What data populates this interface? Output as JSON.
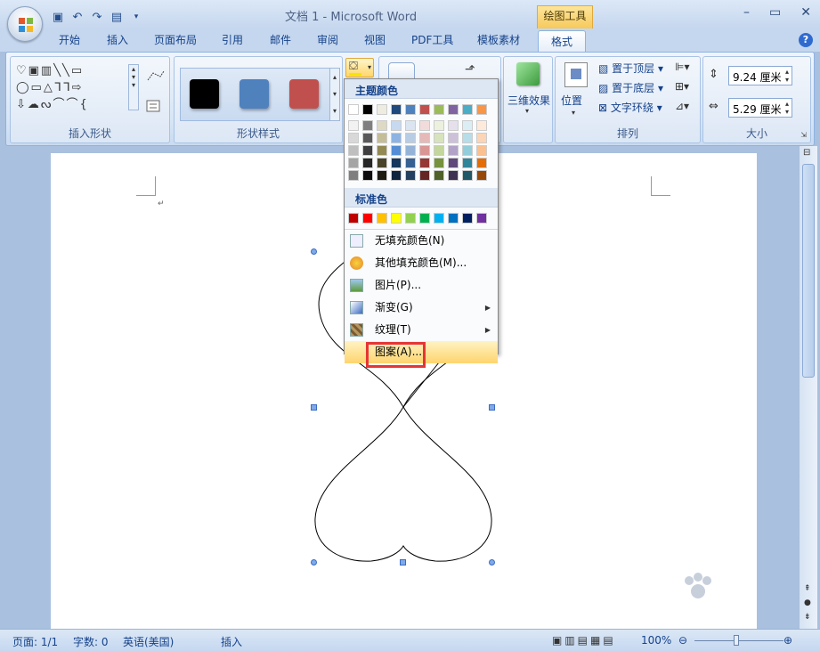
{
  "window": {
    "title": "文档 1 - Microsoft Word",
    "context_tab": "绘图工具"
  },
  "tabs": [
    {
      "label": "开始"
    },
    {
      "label": "插入"
    },
    {
      "label": "页面布局"
    },
    {
      "label": "引用"
    },
    {
      "label": "邮件"
    },
    {
      "label": "审阅"
    },
    {
      "label": "视图"
    },
    {
      "label": "PDF工具"
    },
    {
      "label": "模板素材"
    },
    {
      "label": "格式"
    }
  ],
  "groups": {
    "insert_shapes": "插入形状",
    "shape_styles": "形状样式",
    "arrange": "排列",
    "size": "大小",
    "three_d": "三维效果",
    "position": "位置"
  },
  "arrange": {
    "bring_front": "置于顶层",
    "send_back": "置于底层",
    "text_wrap": "文字环绕"
  },
  "size": {
    "height": "9.24 厘米",
    "width": "5.29 厘米"
  },
  "style_swatches": [
    "#000000",
    "#4f81bd",
    "#c0504d"
  ],
  "fill_menu": {
    "theme_header": "主题颜色",
    "standard_header": "标准色",
    "theme_top": [
      "#ffffff",
      "#000000",
      "#eeece1",
      "#1f497d",
      "#4f81bd",
      "#c0504d",
      "#9bbb59",
      "#8064a2",
      "#4bacc6",
      "#f79646"
    ],
    "theme_shades": [
      [
        "#f2f2f2",
        "#7f7f7f",
        "#ddd9c3",
        "#c6d9f0",
        "#dbe5f1",
        "#f2dcdb",
        "#ebf1dd",
        "#e5e0ec",
        "#dbeef3",
        "#fdeada"
      ],
      [
        "#d8d8d8",
        "#595959",
        "#c4bd97",
        "#8db3e2",
        "#b8cce4",
        "#e5b9b7",
        "#d7e3bc",
        "#ccc1d9",
        "#b7dde8",
        "#fbd5b5"
      ],
      [
        "#bfbfbf",
        "#3f3f3f",
        "#938953",
        "#548dd4",
        "#95b3d7",
        "#d99694",
        "#c3d69b",
        "#b2a2c7",
        "#92cddc",
        "#fac08f"
      ],
      [
        "#a5a5a5",
        "#262626",
        "#494429",
        "#17365d",
        "#366092",
        "#953734",
        "#76923c",
        "#5f497a",
        "#31859b",
        "#e36c09"
      ],
      [
        "#7f7f7f",
        "#0c0c0c",
        "#1d1b10",
        "#0f243e",
        "#244061",
        "#632423",
        "#4f6128",
        "#3f3151",
        "#205867",
        "#974806"
      ]
    ],
    "standard": [
      "#c00000",
      "#ff0000",
      "#ffc000",
      "#ffff00",
      "#92d050",
      "#00b050",
      "#00b0f0",
      "#0070c0",
      "#002060",
      "#7030a0"
    ],
    "items": [
      {
        "label": "无填充颜色(N)",
        "icon": "no-fill-icon"
      },
      {
        "label": "其他填充颜色(M)...",
        "icon": "palette-icon"
      },
      {
        "label": "图片(P)...",
        "icon": "picture-icon"
      },
      {
        "label": "渐变(G)",
        "icon": "gradient-icon"
      },
      {
        "label": "纹理(T)",
        "icon": "texture-icon"
      },
      {
        "label": "图案(A)...",
        "icon": "pattern-icon"
      }
    ]
  },
  "status": {
    "page": "页面: 1/1",
    "words": "字数: 0",
    "lang": "英语(美国)",
    "mode": "插入",
    "zoom": "100%"
  }
}
